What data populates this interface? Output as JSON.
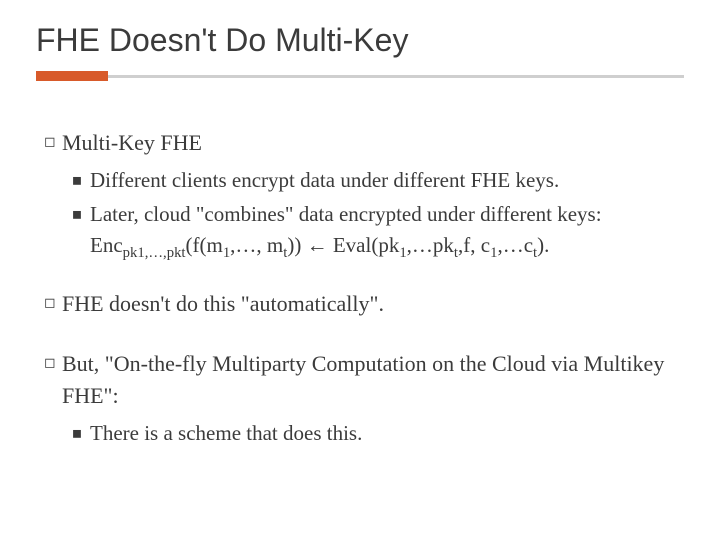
{
  "title": "FHE Doesn't Do Multi-Key",
  "b1": "Multi-Key FHE",
  "b1s1": "Different clients encrypt data under different FHE keys.",
  "b1s2_a": "Later, cloud \"combines\" data encrypted under different keys: Enc",
  "b1s2_sub1": "pk1,…,pkt",
  "b1s2_b": "(f(m",
  "b1s2_sub2": "1",
  "b1s2_c": ",…, m",
  "b1s2_sub3": "t",
  "b1s2_d": ")) ← Eval(pk",
  "b1s2_sub4": "1",
  "b1s2_e": ",…pk",
  "b1s2_sub5": "t",
  "b1s2_f": ",f, c",
  "b1s2_sub6": "1",
  "b1s2_g": ",…c",
  "b1s2_sub7": "t",
  "b1s2_h": ").",
  "b2": "FHE doesn't do this \"automatically\".",
  "b3": "But, \"On-the-fly Multiparty Computation on the Cloud via Multikey FHE\":",
  "b3s1": "There is a scheme that does this."
}
